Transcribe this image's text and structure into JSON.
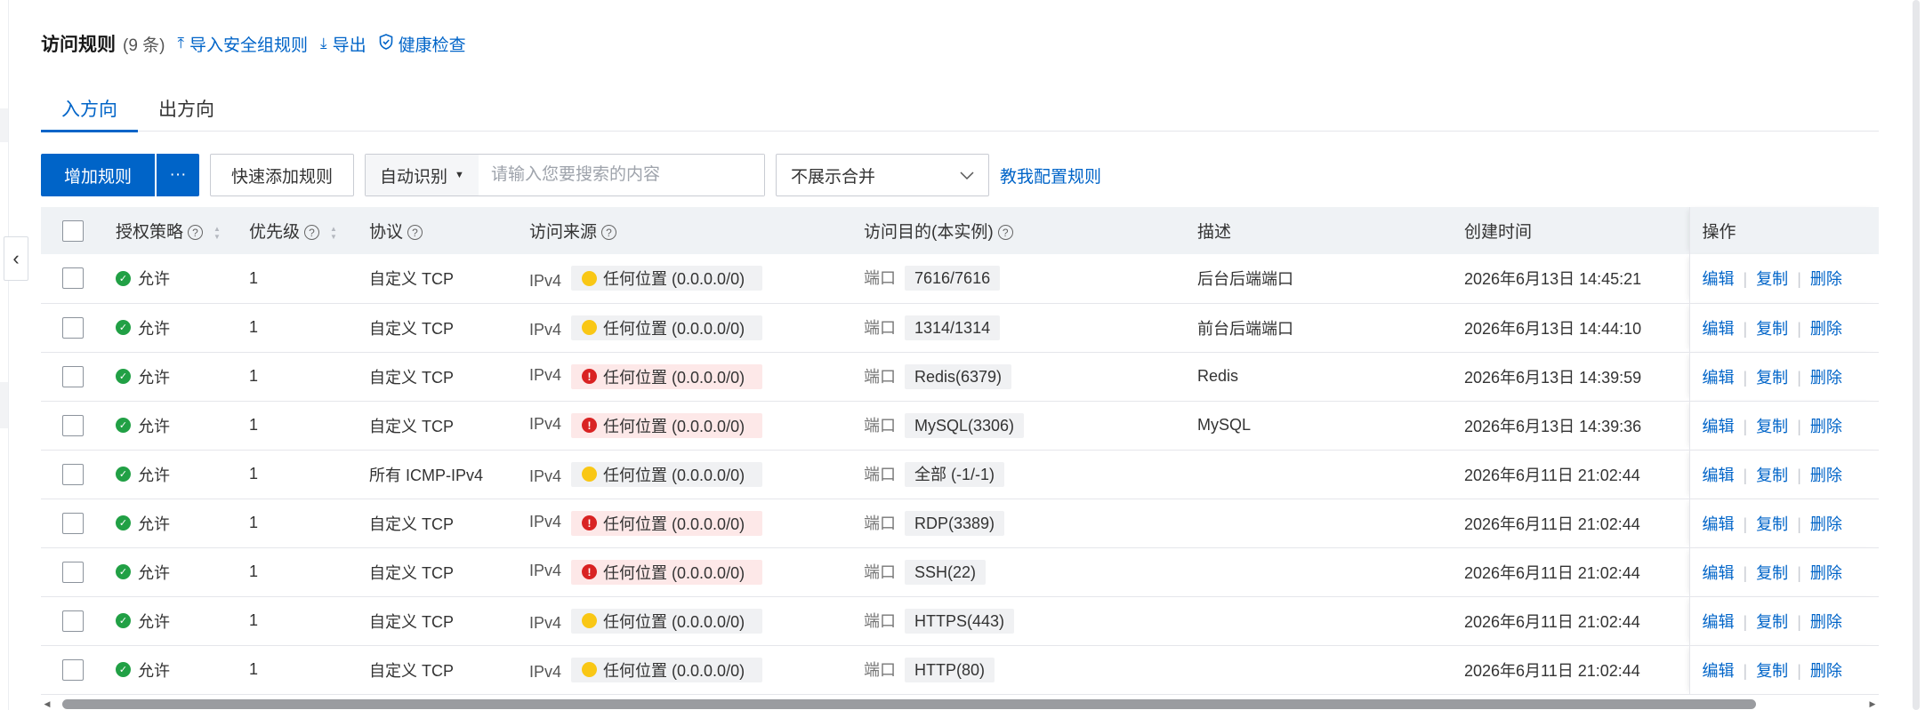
{
  "header": {
    "title": "访问规则",
    "count": "(9 条)",
    "import_label": "导入安全组规则",
    "export_label": "导出",
    "health_label": "健康检查"
  },
  "tabs": [
    {
      "label": "入方向",
      "active": true
    },
    {
      "label": "出方向",
      "active": false
    }
  ],
  "toolbar": {
    "add_rule": "增加规则",
    "more": "···",
    "quick_add": "快速添加规则",
    "search_mode": "自动识别",
    "search_placeholder": "请输入您要搜索的内容",
    "merge_option": "不展示合并",
    "teach_link": "教我配置规则"
  },
  "table": {
    "columns": {
      "policy": "授权策略",
      "priority": "优先级",
      "protocol": "协议",
      "source": "访问来源",
      "dest": "访问目的(本实例)",
      "desc": "描述",
      "created": "创建时间",
      "ops": "操作"
    },
    "ops": {
      "edit": "编辑",
      "copy": "复制",
      "delete": "删除"
    },
    "rows": [
      {
        "policy": "允许",
        "priority": "1",
        "protocol": "自定义 TCP",
        "ip_ver": "IPv4",
        "source": "任何位置 (0.0.0.0/0)",
        "risk": "warn",
        "port_label": "端口",
        "port": "7616/7616",
        "desc": "后台后端端口",
        "created": "2026年6月13日 14:45:21"
      },
      {
        "policy": "允许",
        "priority": "1",
        "protocol": "自定义 TCP",
        "ip_ver": "IPv4",
        "source": "任何位置 (0.0.0.0/0)",
        "risk": "warn",
        "port_label": "端口",
        "port": "1314/1314",
        "desc": "前台后端端口",
        "created": "2026年6月13日 14:44:10"
      },
      {
        "policy": "允许",
        "priority": "1",
        "protocol": "自定义 TCP",
        "ip_ver": "IPv4",
        "source": "任何位置 (0.0.0.0/0)",
        "risk": "danger",
        "port_label": "端口",
        "port": "Redis(6379)",
        "desc": "Redis",
        "created": "2026年6月13日 14:39:59"
      },
      {
        "policy": "允许",
        "priority": "1",
        "protocol": "自定义 TCP",
        "ip_ver": "IPv4",
        "source": "任何位置 (0.0.0.0/0)",
        "risk": "danger",
        "port_label": "端口",
        "port": "MySQL(3306)",
        "desc": "MySQL",
        "created": "2026年6月13日 14:39:36"
      },
      {
        "policy": "允许",
        "priority": "1",
        "protocol": "所有 ICMP-IPv4",
        "ip_ver": "IPv4",
        "source": "任何位置 (0.0.0.0/0)",
        "risk": "warn",
        "port_label": "端口",
        "port": "全部 (-1/-1)",
        "desc": "",
        "created": "2026年6月11日 21:02:44"
      },
      {
        "policy": "允许",
        "priority": "1",
        "protocol": "自定义 TCP",
        "ip_ver": "IPv4",
        "source": "任何位置 (0.0.0.0/0)",
        "risk": "danger",
        "port_label": "端口",
        "port": "RDP(3389)",
        "desc": "",
        "created": "2026年6月11日 21:02:44"
      },
      {
        "policy": "允许",
        "priority": "1",
        "protocol": "自定义 TCP",
        "ip_ver": "IPv4",
        "source": "任何位置 (0.0.0.0/0)",
        "risk": "danger",
        "port_label": "端口",
        "port": "SSH(22)",
        "desc": "",
        "created": "2026年6月11日 21:02:44"
      },
      {
        "policy": "允许",
        "priority": "1",
        "protocol": "自定义 TCP",
        "ip_ver": "IPv4",
        "source": "任何位置 (0.0.0.0/0)",
        "risk": "warn",
        "port_label": "端口",
        "port": "HTTPS(443)",
        "desc": "",
        "created": "2026年6月11日 21:02:44"
      },
      {
        "policy": "允许",
        "priority": "1",
        "protocol": "自定义 TCP",
        "ip_ver": "IPv4",
        "source": "任何位置 (0.0.0.0/0)",
        "risk": "warn",
        "port_label": "端口",
        "port": "HTTP(80)",
        "desc": "",
        "created": "2026年6月11日 21:02:44"
      }
    ]
  },
  "icons": {
    "import": "import-icon",
    "export": "download-icon",
    "health": "shield-check-icon",
    "collapse": "chevron-left-icon",
    "help": "help-circle-icon",
    "sort": "sort-icon"
  },
  "colors": {
    "primary": "#0064c8",
    "allow": "#21a045",
    "warn": "#f9c715",
    "danger": "#d92323",
    "danger_bg": "#fde8e8"
  }
}
